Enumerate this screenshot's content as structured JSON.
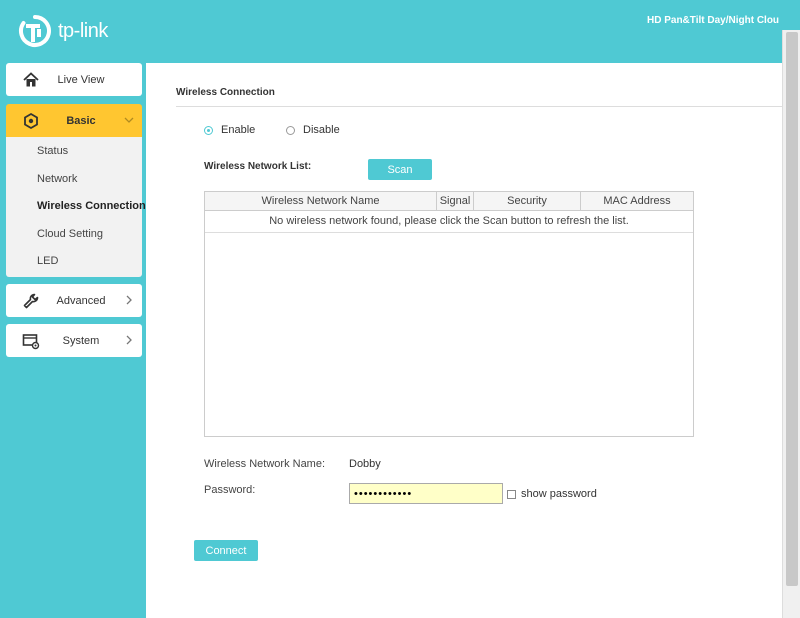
{
  "header": {
    "logo_text": "tp-link",
    "device_title": "HD Pan&Tilt Day/Night Clou"
  },
  "sidebar": {
    "live_view": "Live View",
    "basic": "Basic",
    "submenu": [
      "Status",
      "Network",
      "Wireless Connection",
      "Cloud Setting",
      "LED"
    ],
    "advanced": "Advanced",
    "system": "System"
  },
  "main": {
    "section_title": "Wireless Connection",
    "enable_label": "Enable",
    "disable_label": "Disable",
    "network_list_label": "Wireless Network List:",
    "scan_label": "Scan",
    "table": {
      "columns": [
        "Wireless Network Name",
        "Signal",
        "Security",
        "MAC Address"
      ],
      "empty_message": "No wireless network found, please click the Scan button to refresh the list."
    },
    "network_name_label": "Wireless Network Name:",
    "network_name_value": "Dobby",
    "password_label": "Password:",
    "password_value": "••••••••••••",
    "show_password_label": "show password",
    "connect_label": "Connect"
  },
  "colors": {
    "accent": "#4fc9d3",
    "active_menu": "#ffc630",
    "password_bg": "#ffffc8"
  }
}
